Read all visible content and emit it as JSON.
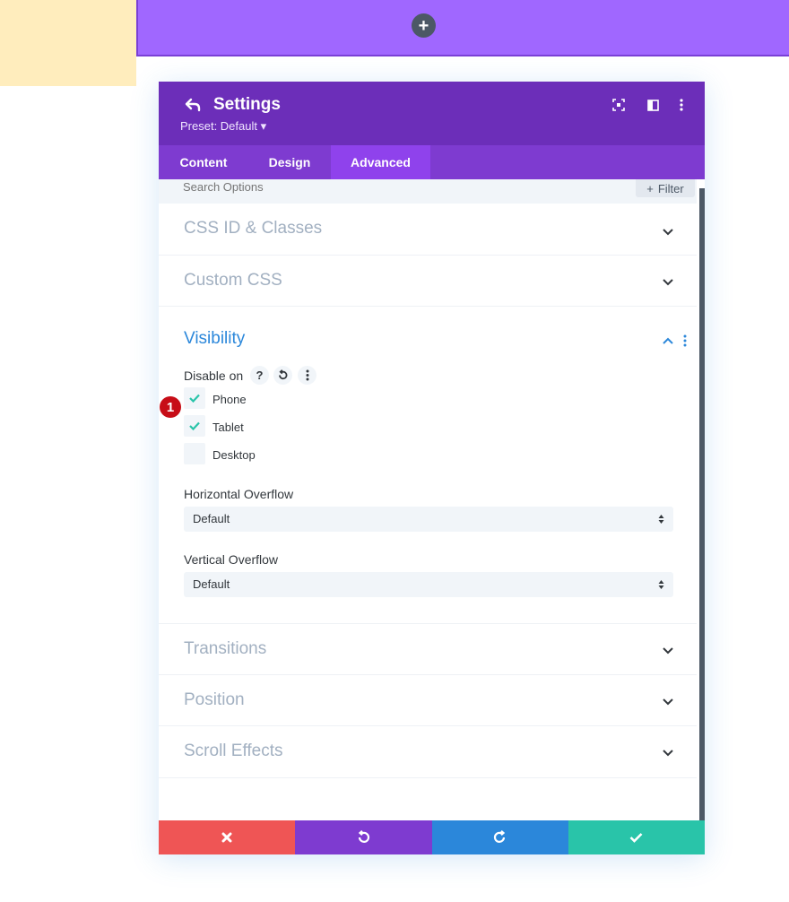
{
  "colors": {
    "header_bg": "#6c2eb9",
    "tabs_bg": "#7e3bd0",
    "active_tab_bg": "#8f42ec",
    "accent_blue": "#2b87da",
    "check_teal": "#29c4a9",
    "cancel_red": "#ef5555",
    "undo_purple": "#7e3bd0",
    "redo_blue": "#2b87da",
    "save_teal": "#29c4a9",
    "badge_red": "#c70d17"
  },
  "canvas": {
    "add_icon": "+"
  },
  "modal": {
    "title": "Settings",
    "preset": "Preset: Default ▾",
    "header_icons": [
      "back-arrow-icon",
      "fullscreen-icon",
      "sidebar-layout-icon",
      "more-vertical-icon"
    ]
  },
  "tabs": [
    {
      "label": "Content",
      "active": false
    },
    {
      "label": "Design",
      "active": false
    },
    {
      "label": "Advanced",
      "active": true
    }
  ],
  "search": {
    "placeholder": "Search Options",
    "filter_label": "Filter",
    "filter_icon": "+"
  },
  "sections": {
    "css": "CSS ID & Classes",
    "custom_css": "Custom CSS",
    "visibility": "Visibility",
    "transitions": "Transitions",
    "position": "Position",
    "scroll_effects": "Scroll Effects"
  },
  "visibility": {
    "disable_on_label": "Disable on",
    "help_icon": "?",
    "options": [
      {
        "label": "Phone",
        "checked": true
      },
      {
        "label": "Tablet",
        "checked": true
      },
      {
        "label": "Desktop",
        "checked": false
      }
    ],
    "horizontal_overflow": {
      "label": "Horizontal Overflow",
      "value": "Default"
    },
    "vertical_overflow": {
      "label": "Vertical Overflow",
      "value": "Default"
    }
  },
  "annotation_badge": "1"
}
